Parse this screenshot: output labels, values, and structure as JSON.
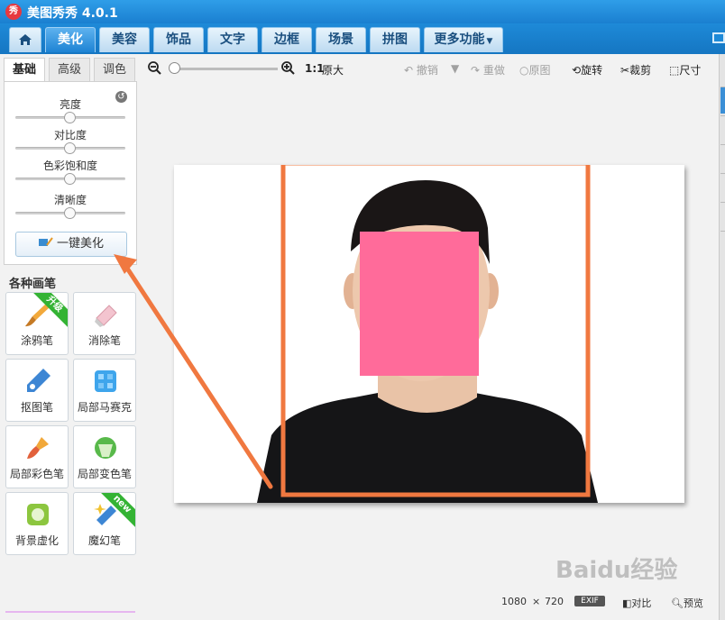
{
  "app": {
    "logo_char": "秀",
    "title": "美图秀秀 4.0.1"
  },
  "tabs": [
    {
      "label": "美化",
      "active": true
    },
    {
      "label": "美容"
    },
    {
      "label": "饰品"
    },
    {
      "label": "文字"
    },
    {
      "label": "边框"
    },
    {
      "label": "场景"
    },
    {
      "label": "拼图"
    },
    {
      "label": "更多功能"
    }
  ],
  "subtabs": [
    "基础",
    "高级",
    "调色"
  ],
  "adjust": {
    "sliders": [
      {
        "label": "亮度",
        "value": 0.5
      },
      {
        "label": "对比度",
        "value": 0.5
      },
      {
        "label": "色彩饱和度",
        "value": 0.5
      },
      {
        "label": "清晰度",
        "value": 0.5
      }
    ],
    "onekey_label": "一键美化"
  },
  "brushes": {
    "title": "各种画笔",
    "items": [
      {
        "label": "涂鸦笔",
        "icon": "paint-brush-icon",
        "badge": "升级"
      },
      {
        "label": "消除笔",
        "icon": "eraser-icon"
      },
      {
        "label": "抠图笔",
        "icon": "cutout-pen-icon"
      },
      {
        "label": "局部马赛克",
        "icon": "mosaic-icon"
      },
      {
        "label": "局部彩色笔",
        "icon": "color-brush-icon"
      },
      {
        "label": "局部变色笔",
        "icon": "color-change-icon"
      },
      {
        "label": "背景虚化",
        "icon": "blur-background-icon"
      },
      {
        "label": "魔幻笔",
        "icon": "magic-pen-icon",
        "badge": "new"
      }
    ]
  },
  "toolbar": {
    "ratio": "1:1",
    "original_size": "原大",
    "undo": "撤销",
    "redo": "重做",
    "original": "原图",
    "rotate": "旋转",
    "crop": "裁剪",
    "size": "尺寸",
    "zoom_level": 0.05
  },
  "status": {
    "width": "1080",
    "x": "×",
    "height": "720",
    "exif": "EXIF",
    "compare": "对比",
    "preview": "预览"
  },
  "watermark": "Baidu经验",
  "colors": {
    "accent": "#1a7fd0",
    "highlight_box": "#f07840",
    "face_mask": "#ff6b9a"
  }
}
